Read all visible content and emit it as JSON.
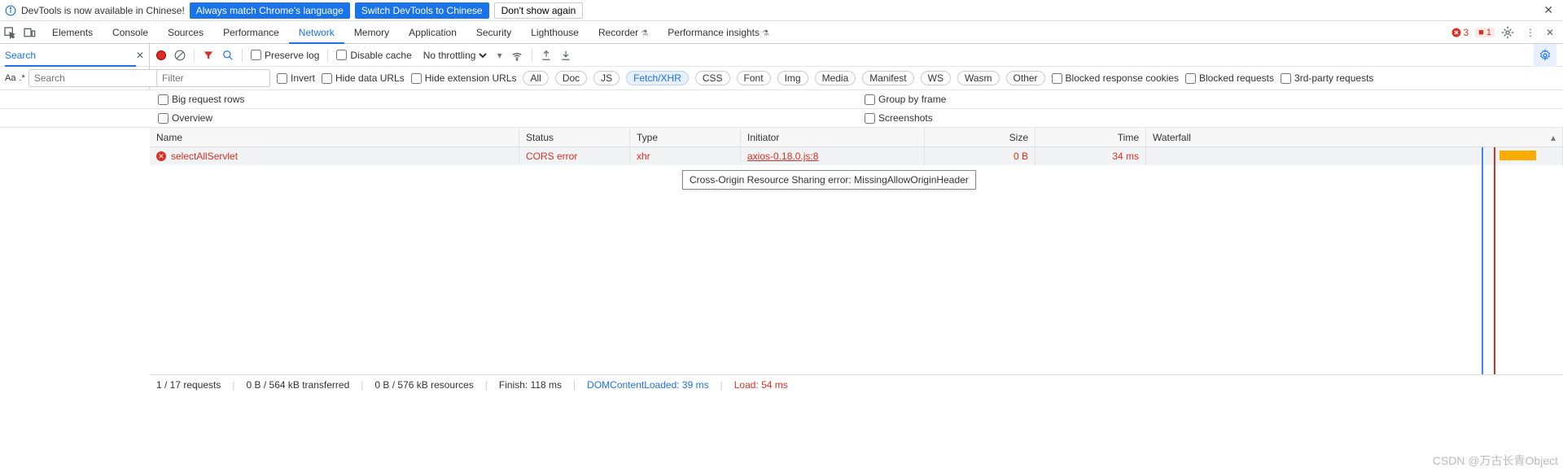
{
  "infobar": {
    "text": "DevTools is now available in Chinese!",
    "btn_match": "Always match Chrome's language",
    "btn_switch": "Switch DevTools to Chinese",
    "btn_dismiss": "Don't show again"
  },
  "tabs": {
    "elements": "Elements",
    "console": "Console",
    "sources": "Sources",
    "performance": "Performance",
    "network": "Network",
    "memory": "Memory",
    "application": "Application",
    "security": "Security",
    "lighthouse": "Lighthouse",
    "recorder": "Recorder",
    "perf_insights": "Performance insights",
    "error_count": "3",
    "issue_count": "1"
  },
  "search": {
    "tab_label": "Search",
    "placeholder": "Search"
  },
  "net_toolbar": {
    "preserve_log": "Preserve log",
    "disable_cache": "Disable cache",
    "throttling": "No throttling"
  },
  "filter": {
    "placeholder": "Filter",
    "invert": "Invert",
    "hide_data": "Hide data URLs",
    "hide_ext": "Hide extension URLs",
    "pills": {
      "all": "All",
      "doc": "Doc",
      "js": "JS",
      "fetch": "Fetch/XHR",
      "css": "CSS",
      "font": "Font",
      "img": "Img",
      "media": "Media",
      "manifest": "Manifest",
      "ws": "WS",
      "wasm": "Wasm",
      "other": "Other"
    },
    "blocked_resp": "Blocked response cookies",
    "blocked_req": "Blocked requests",
    "third_party": "3rd-party requests"
  },
  "opts": {
    "big_rows": "Big request rows",
    "group_frame": "Group by frame",
    "overview": "Overview",
    "screenshots": "Screenshots"
  },
  "columns": {
    "name": "Name",
    "status": "Status",
    "type": "Type",
    "initiator": "Initiator",
    "size": "Size",
    "time": "Time",
    "waterfall": "Waterfall"
  },
  "row": {
    "name": "selectAllServlet",
    "status": "CORS error",
    "type": "xhr",
    "initiator": "axios-0.18.0.js:8",
    "size": "0 B",
    "time": "34 ms"
  },
  "tooltip": "Cross-Origin Resource Sharing error: MissingAllowOriginHeader",
  "footer": {
    "requests": "1 / 17 requests",
    "transferred": "0 B / 564 kB transferred",
    "resources": "0 B / 576 kB resources",
    "finish": "Finish: 118 ms",
    "dcl": "DOMContentLoaded: 39 ms",
    "load": "Load: 54 ms"
  },
  "watermark": "CSDN @万古长青Object"
}
